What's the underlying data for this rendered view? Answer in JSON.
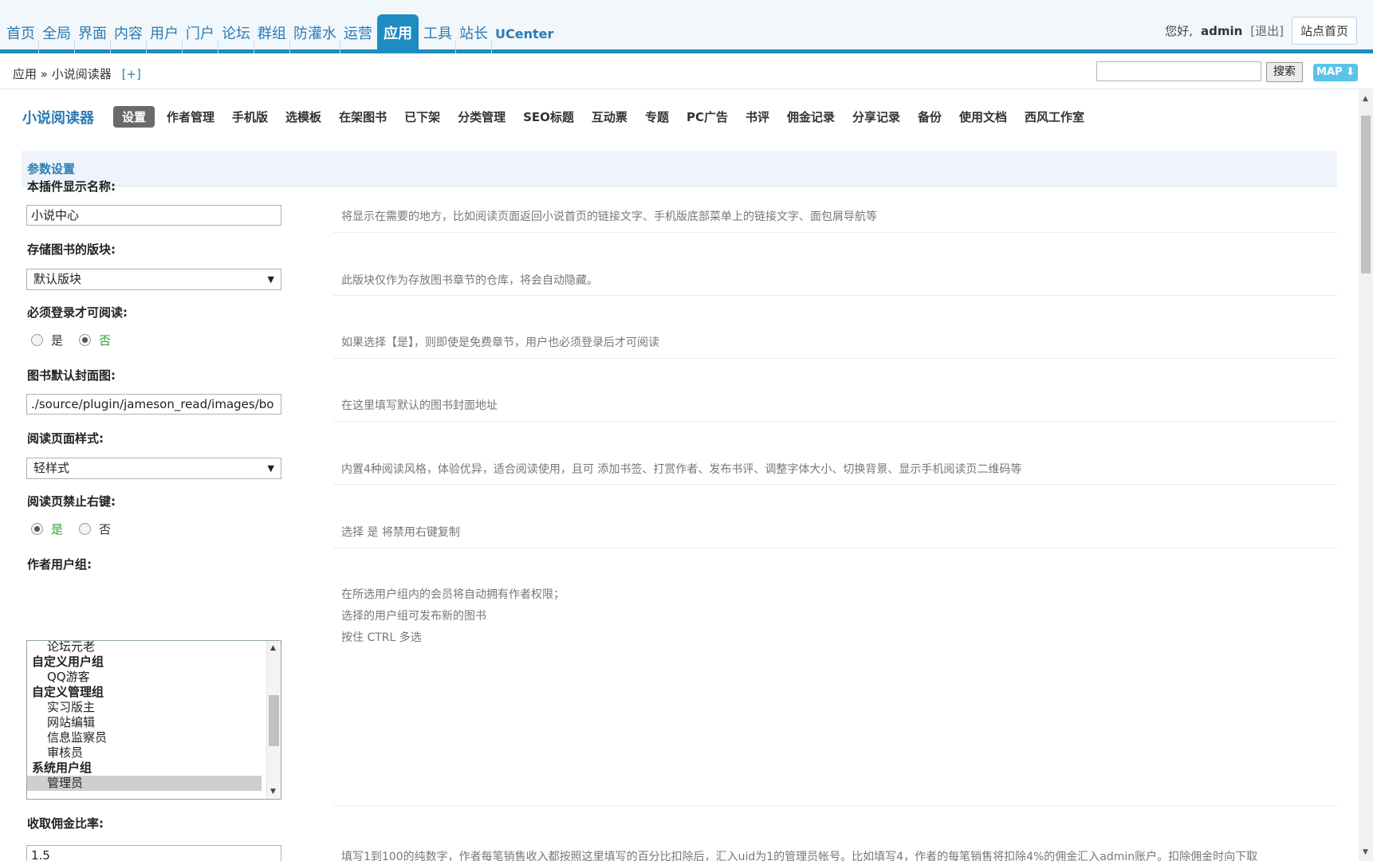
{
  "topnav": {
    "items": [
      "首页",
      "全局",
      "界面",
      "内容",
      "用户",
      "门户",
      "论坛",
      "群组",
      "防灌水",
      "运营",
      "应用",
      "工具",
      "站长",
      "UCenter"
    ],
    "active": "应用"
  },
  "user": {
    "greeting": "您好,",
    "name": "admin",
    "logout": "[退出]",
    "site_home": "站点首页"
  },
  "breadcrumb": {
    "parent": "应用",
    "sep": "»",
    "current": "小说阅读器",
    "plus": "[+]"
  },
  "search": {
    "value": "",
    "button": "搜索",
    "map": "MAP"
  },
  "plugin": {
    "title": "小说阅读器",
    "tabs": [
      "设置",
      "作者管理",
      "手机版",
      "选模板",
      "在架图书",
      "已下架",
      "分类管理",
      "SEO标题",
      "互动票",
      "专题",
      "PC广告",
      "书评",
      "佣金记录",
      "分享记录",
      "备份",
      "使用文档",
      "西风工作室"
    ],
    "active_tab": "设置"
  },
  "section": {
    "title": "参数设置"
  },
  "settings": {
    "display_name": {
      "label": "本插件显示名称:",
      "value": "小说中心",
      "hint": "将显示在需要的地方，比如阅读页面返回小说首页的链接文字、手机版底部菜单上的链接文字、面包屑导航等"
    },
    "storage_forum": {
      "label": "存储图书的版块:",
      "value": "默认版块",
      "hint": "此版块仅作为存放图书章节的仓库，将会自动隐藏。"
    },
    "login_required": {
      "label": "必须登录才可阅读:",
      "yes": "是",
      "no": "否",
      "selected": "否",
      "hint": "如果选择【是】，则即使是免费章节，用户也必须登录后才可阅读"
    },
    "default_cover": {
      "label": "图书默认封面图:",
      "value": "./source/plugin/jameson_read/images/bo",
      "hint": "在这里填写默认的图书封面地址"
    },
    "reading_style": {
      "label": "阅读页面样式:",
      "value": "轻样式",
      "hint": "内置4种阅读风格，体验优异，适合阅读使用，且可 添加书签、打赏作者、发布书评、调整字体大小、切换背景、显示手机阅读页二维码等"
    },
    "disable_right_click": {
      "label": "阅读页禁止右键:",
      "yes": "是",
      "no": "否",
      "selected": "是",
      "hint": "选择 是 将禁用右键复制"
    },
    "author_groups": {
      "label": "作者用户组:",
      "options": [
        {
          "text": "论坛元老",
          "kind": "child"
        },
        {
          "text": "自定义用户组",
          "kind": "group"
        },
        {
          "text": "QQ游客",
          "kind": "child"
        },
        {
          "text": "自定义管理组",
          "kind": "group"
        },
        {
          "text": "实习版主",
          "kind": "child"
        },
        {
          "text": "网站编辑",
          "kind": "child"
        },
        {
          "text": "信息监察员",
          "kind": "child"
        },
        {
          "text": "审核员",
          "kind": "child"
        },
        {
          "text": "系统用户组",
          "kind": "group"
        },
        {
          "text": "管理员",
          "kind": "child",
          "selected": true
        }
      ],
      "hint1": "在所选用户组内的会员将自动拥有作者权限；",
      "hint2": "选择的用户组可发布新的图书",
      "hint3": "按住 CTRL 多选"
    },
    "commission_rate": {
      "label": "收取佣金比率:",
      "value": "1.5",
      "hint": "填写1到100的纯数字，作者每笔销售收入都按照这里填写的百分比扣除后，汇入uid为1的管理员帐号。比如填写4，作者的每笔销售将扣除4%的佣金汇入admin账户。扣除佣金时向下取"
    }
  }
}
